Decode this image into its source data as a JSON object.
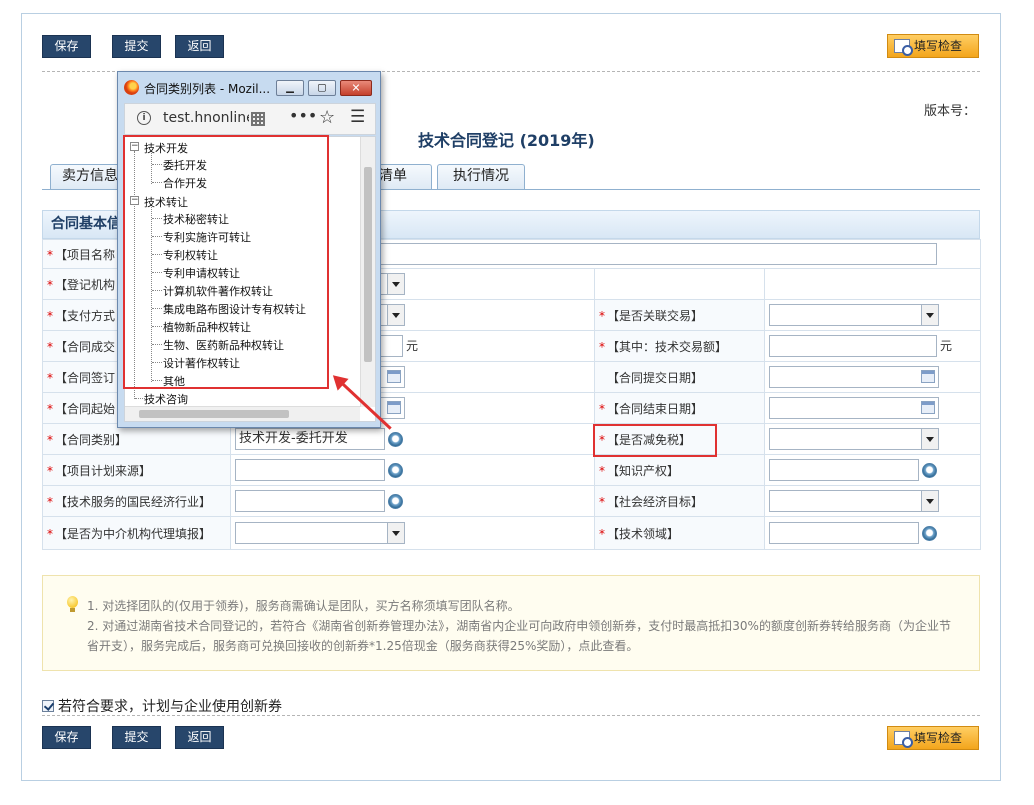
{
  "toolbar": {
    "save": "保存",
    "submit": "提交",
    "back": "返回",
    "check": "填写检查"
  },
  "header": {
    "version_label": "版本号：",
    "title": "技术合同登记 (2019年)"
  },
  "tabs": [
    {
      "label": "卖方信息"
    },
    {
      "label": "清单"
    },
    {
      "label": "执行情况"
    }
  ],
  "section": {
    "title": "合同基本信息"
  },
  "form": {
    "project_name": "【项目名称",
    "reg_org": "【登记机构",
    "payment": "【支付方式",
    "related_tx": "【是否关联交易】",
    "deal_amount": "【合同成交",
    "tech_tx_amount": "【其中：技术交易额】",
    "unit": "元",
    "sign_date": "【合同签订",
    "submit_date": "【合同提交日期】",
    "start_date": "【合同起始",
    "end_date": "【合同结束日期】",
    "contract_type": "【合同类别】",
    "contract_type_value": "技术开发-委托开发",
    "tax_relief": "【是否减免税】",
    "plan_source": "【项目计划来源】",
    "ip": "【知识产权】",
    "industry": "【技术服务的国民经济行业】",
    "econ_goal": "【社会经济目标】",
    "agent": "【是否为中介机构代理填报】",
    "tech_field": "【技术领域】"
  },
  "notice": {
    "line1": "1. 对选择团队的(仅用于领券)，服务商需确认是团队，买方名称须填写团队名称。",
    "line2": "2. 对通过湖南省技术合同登记的，若符合《湖南省创新券管理办法》，湖南省内企业可向政府申领创新券，支付时最高抵扣30%的额度创新券转给服务商（为企业节",
    "line3": "省开支），服务完成后，服务商可兑换回接收的创新券*1.25倍现金（服务商获得25%奖励），点此查看。"
  },
  "agree": {
    "label": "若符合要求，计划与企业使用创新券"
  },
  "popup": {
    "title": "合同类别列表 - Mozil...",
    "url": "test.hnonline",
    "tree": {
      "dev": "技术开发",
      "dev_items": [
        "委托开发",
        "合作开发"
      ],
      "transfer": "技术转让",
      "transfer_items": [
        "技术秘密转让",
        "专利实施许可转让",
        "专利权转让",
        "专利申请权转让",
        "计算机软件著作权转让",
        "集成电路布图设计专有权转让",
        "植物新品种权转让",
        "生物、医药新品种权转让",
        "设计著作权转让",
        "其他"
      ],
      "consult": "技术咨询"
    }
  },
  "colors": {
    "button_dark": "#27466b",
    "button_orange": "#f3a51c",
    "annotation_red": "#e03131",
    "title_blue": "#1f3f66"
  }
}
